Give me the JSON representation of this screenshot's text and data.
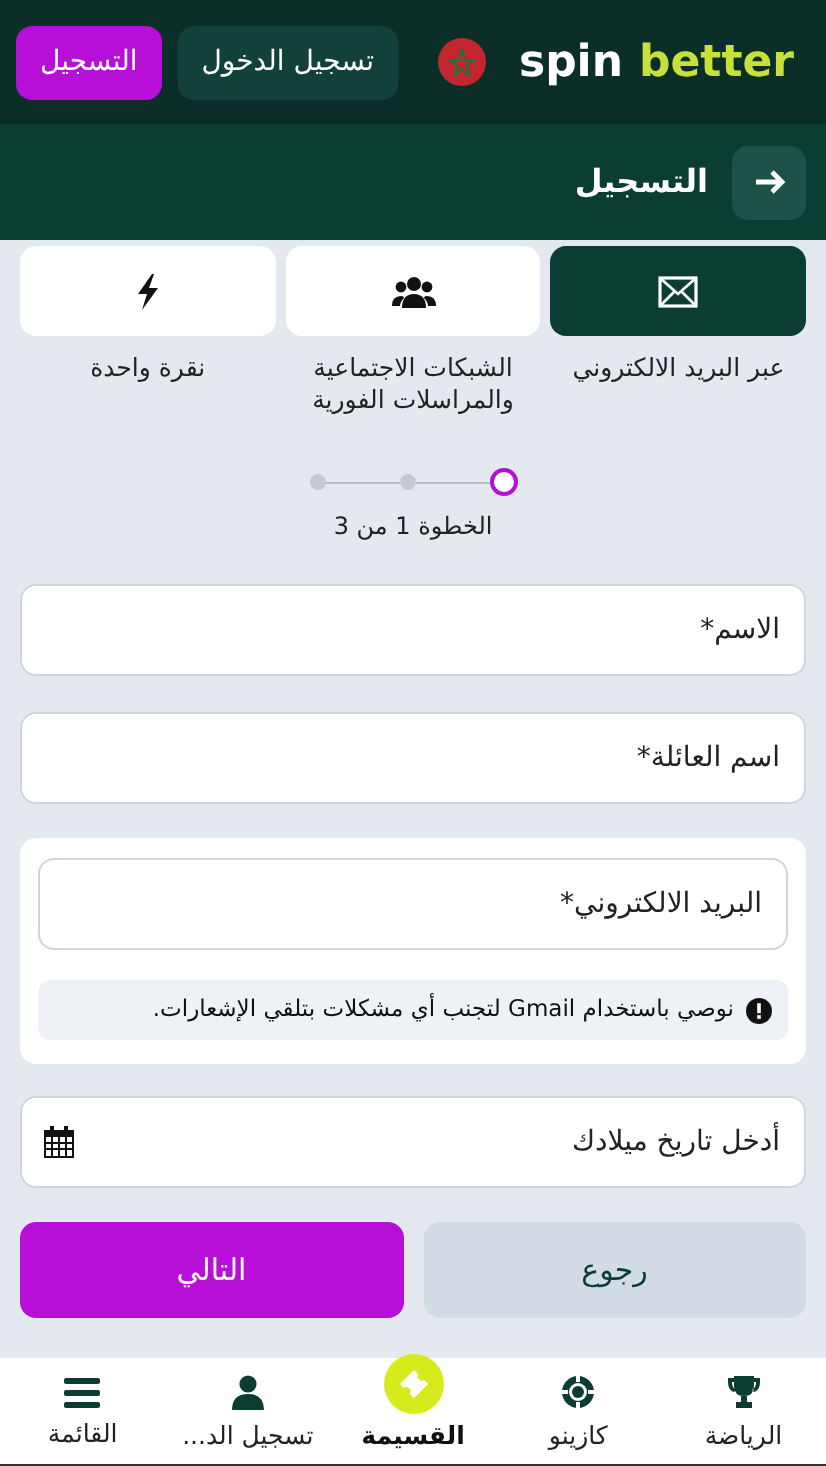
{
  "header": {
    "logo": {
      "part_1": "spin",
      "part_2": "better"
    },
    "login_button": "تسجيل الدخول",
    "register_button": "التسجيل"
  },
  "page_title": "التسجيل",
  "methods": [
    {
      "label": "عبر البريد الالكتروني",
      "kind": "email",
      "selected": true
    },
    {
      "label": "الشبكات الاجتماعية والمراسلات الفورية",
      "kind": "social",
      "selected": false
    },
    {
      "label": "نقرة واحدة",
      "kind": "click",
      "selected": false
    }
  ],
  "steps": [
    {
      "selected": true
    },
    {
      "selected": false
    },
    {
      "selected": false
    }
  ],
  "step_text": "الخطوة 1 من 3",
  "fields": [
    {
      "placeholder": "الاسم*"
    },
    {
      "placeholder": "اسم العائلة*"
    }
  ],
  "email_card": {
    "placeholder": "البريد الالكتروني*",
    "notice": "نوصي باستخدام Gmail لتجنب أي مشكلات بتلقي الإشعارات."
  },
  "birth_date": {
    "placeholder": "أدخل تاريخ ميلادك"
  },
  "buttons": {
    "back": "رجوع",
    "next": "التالي"
  },
  "bottom_nav": [
    {
      "label": "الرياضة",
      "kind": "trophy",
      "selected": false
    },
    {
      "label": "كازينو",
      "kind": "chip",
      "selected": false
    },
    {
      "label": "القسيمة",
      "kind": "ticket",
      "selected": true
    },
    {
      "label": "تسجيل الد...",
      "kind": "person",
      "selected": false
    },
    {
      "label": "القائمة",
      "kind": "menu",
      "selected": false
    }
  ]
}
